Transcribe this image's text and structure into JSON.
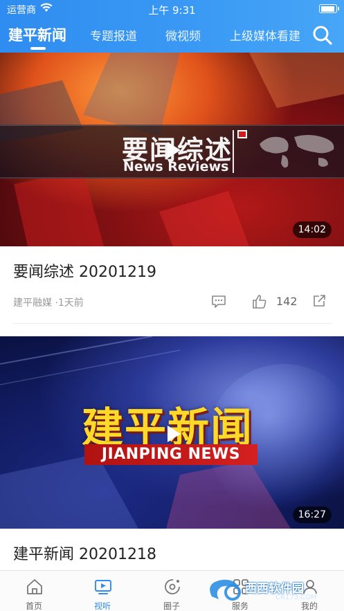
{
  "status_bar": {
    "carrier": "运营商",
    "time": "上午 9:31"
  },
  "top_tabs": [
    {
      "label": "建平新闻",
      "active": true
    },
    {
      "label": "专题报道",
      "active": false
    },
    {
      "label": "微视频",
      "active": false
    },
    {
      "label": "上级媒体看建",
      "active": false
    }
  ],
  "icons": {
    "search": "search-icon",
    "play": "play-icon",
    "comment": "comment-icon",
    "like": "thumbs-up-icon",
    "share": "share-icon"
  },
  "colors": {
    "brand_blue": "#2f8cf0",
    "text_dark": "#222222",
    "text_gray": "#999999"
  },
  "feed": [
    {
      "thumbnail_title_cn": "要闻综述",
      "thumbnail_title_en": "News Reviews",
      "duration": "14:02",
      "title": "要闻综述 20201219",
      "source": "建平融媒 ·1天前",
      "likes": "142"
    },
    {
      "thumbnail_title_cn": "建平新闻",
      "thumbnail_title_en": "JIANPING NEWS",
      "duration": "16:27",
      "title": "建平新闻 20201218"
    }
  ],
  "bottom_tabs": [
    {
      "label": "首页",
      "active": false
    },
    {
      "label": "视听",
      "active": true
    },
    {
      "label": "圈子",
      "active": false
    },
    {
      "label": "服务",
      "active": false
    },
    {
      "label": "我的",
      "active": false
    }
  ],
  "watermark": {
    "brand": "西西软件园",
    "url": "CR173.COM"
  }
}
